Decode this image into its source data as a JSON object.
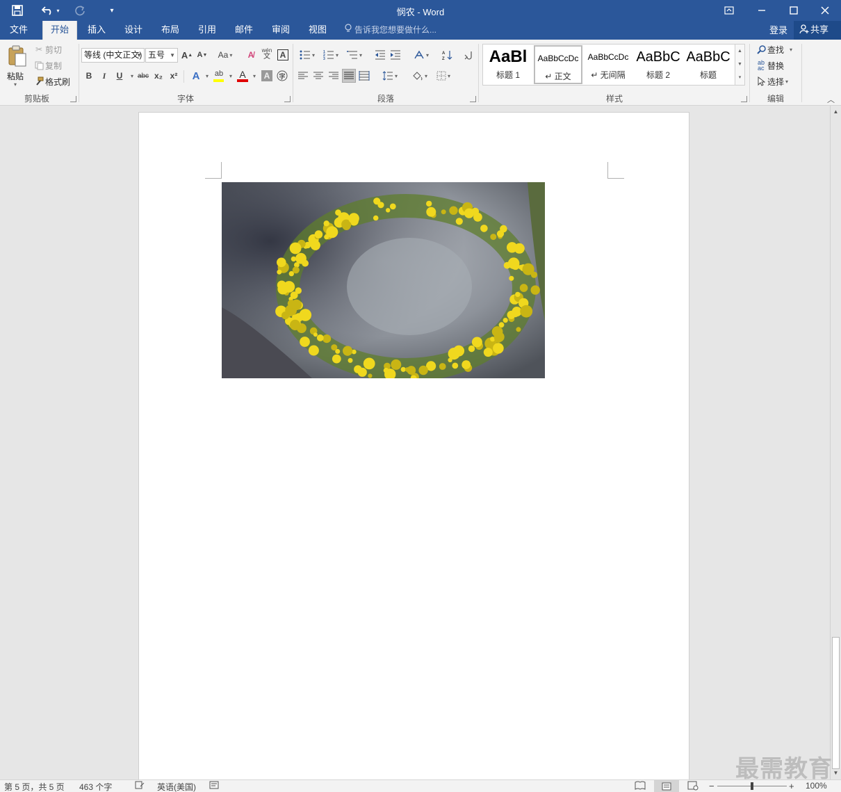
{
  "window": {
    "title": "悯农 - Word",
    "quick_access": {
      "save_icon": "save-icon",
      "undo_icon": "undo-icon",
      "redo_icon": "redo-icon",
      "customize_icon": "customize-qat-icon"
    },
    "controls": {
      "ribbon_display": "ribbon-display-options-icon",
      "minimize": "minimize-icon",
      "maximize": "maximize-icon",
      "close": "close-icon"
    }
  },
  "tabs": [
    {
      "label": "文件"
    },
    {
      "label": "开始"
    },
    {
      "label": "插入"
    },
    {
      "label": "设计"
    },
    {
      "label": "布局"
    },
    {
      "label": "引用"
    },
    {
      "label": "邮件"
    },
    {
      "label": "审阅"
    },
    {
      "label": "视图"
    }
  ],
  "active_tab": "开始",
  "tellme_placeholder": "告诉我您想要做什么...",
  "login_label": "登录",
  "share_label": "共享",
  "ribbon": {
    "clipboard": {
      "label": "剪贴板",
      "paste": "粘贴",
      "cut": "剪切",
      "copy": "复制",
      "format_painter": "格式刷"
    },
    "font": {
      "label": "字体",
      "font_name": "等线 (中文正文)",
      "font_size": "五号",
      "bold": "B",
      "italic": "I",
      "underline": "U",
      "strike": "abc",
      "subscript": "x₂",
      "superscript": "x²",
      "pinyin": "wén",
      "font_color_sample": "A",
      "highlight_color": "#ffff00",
      "font_color": "#e00000"
    },
    "paragraph": {
      "label": "段落"
    },
    "styles": {
      "label": "样式",
      "items": [
        {
          "sample": "AaBl",
          "name": "标题 1"
        },
        {
          "sample": "AaBbCcDc",
          "name": "↵ 正文"
        },
        {
          "sample": "AaBbCcDc",
          "name": "↵ 无间隔"
        },
        {
          "sample": "AaBbC",
          "name": "标题 2"
        },
        {
          "sample": "AaBbC",
          "name": "标题"
        }
      ]
    },
    "editing": {
      "label": "编辑",
      "find": "查找",
      "replace": "替换",
      "select": "选择"
    }
  },
  "document": {
    "image_description": "yellow-flower-wreath-on-rock-photo"
  },
  "status": {
    "page": "第 5 页，共 5 页",
    "words": "463 个字",
    "language": "英语(美国)",
    "zoom": "100%",
    "zoom_fraction": 0.5
  },
  "watermark": "最需教育"
}
